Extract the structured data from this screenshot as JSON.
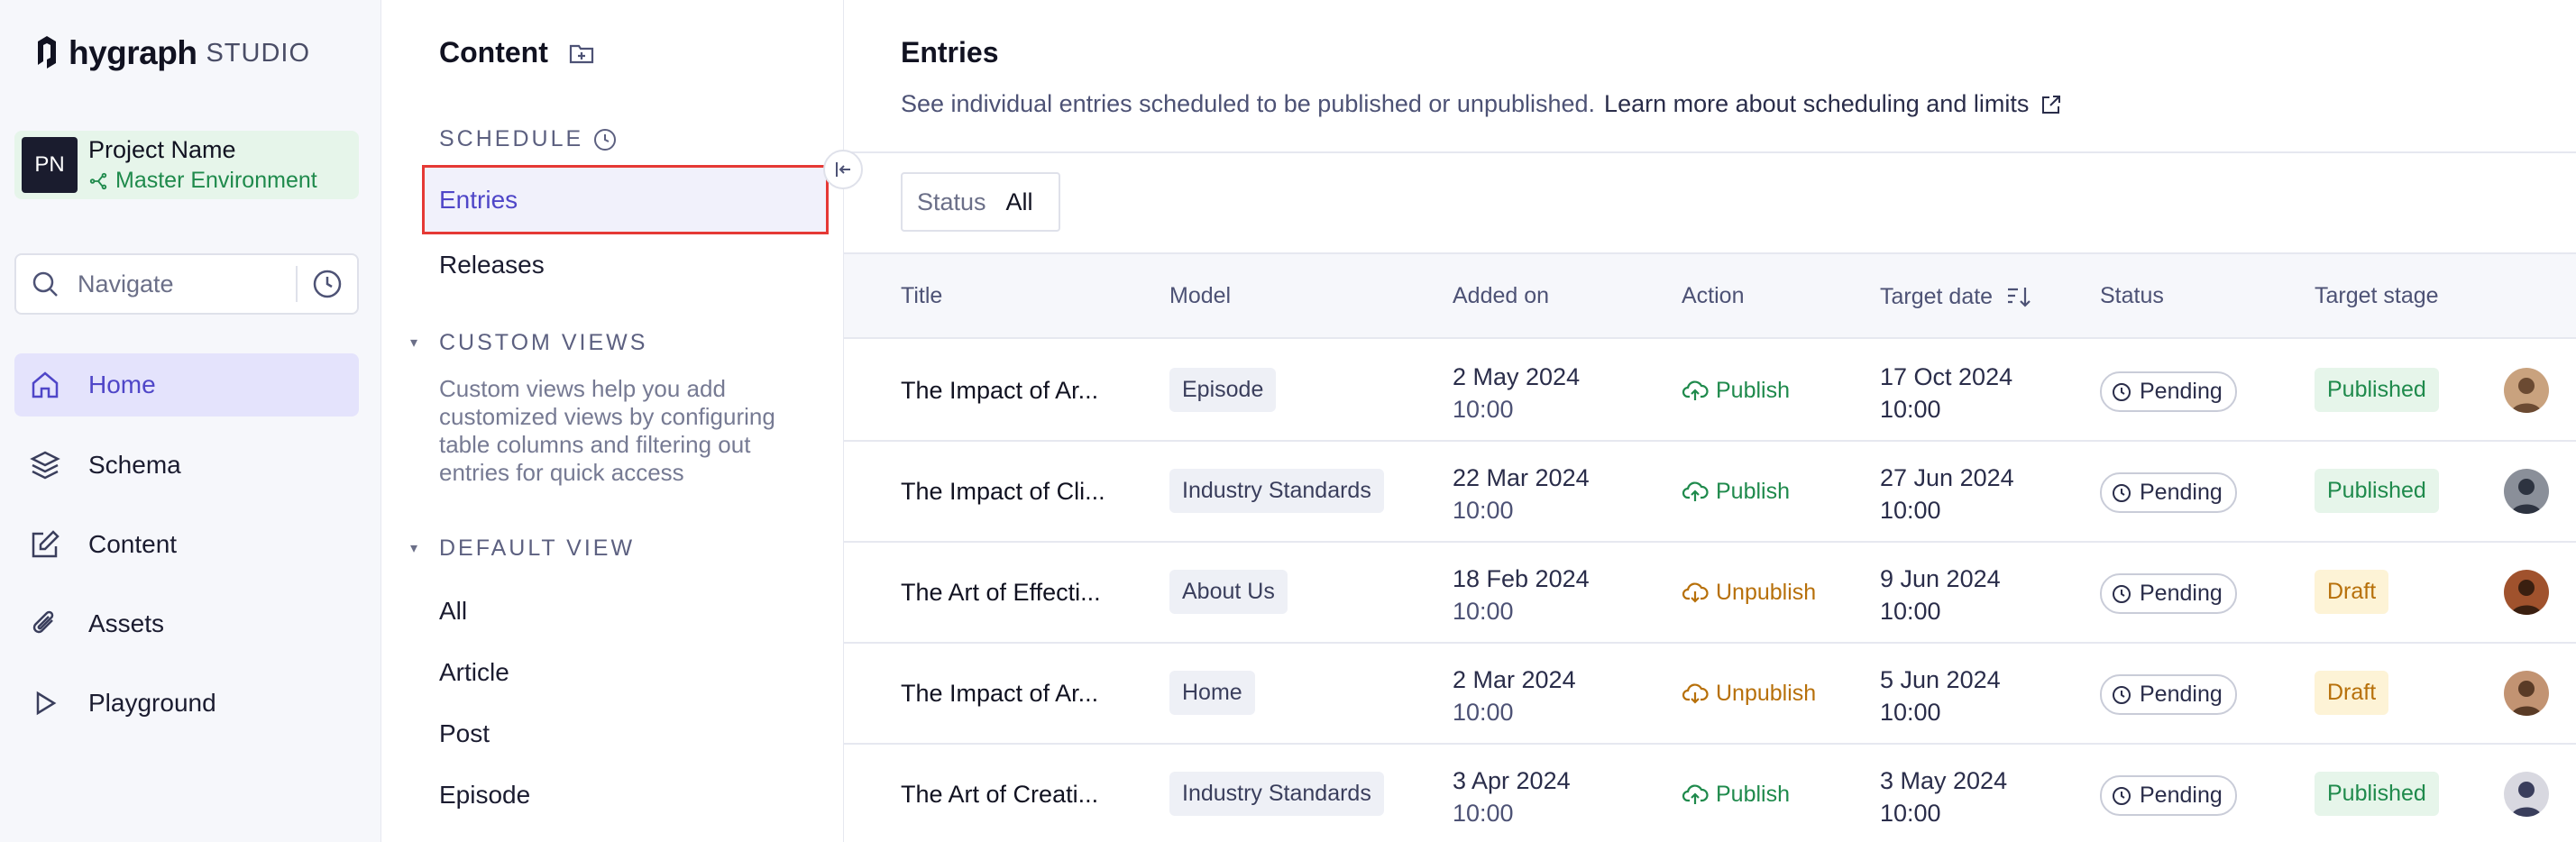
{
  "brand": {
    "name": "hygraph",
    "suffix": "STUDIO"
  },
  "project": {
    "initials": "PN",
    "name": "Project Name",
    "environment": "Master Environment"
  },
  "navigate": {
    "placeholder": "Navigate"
  },
  "nav": {
    "items": [
      {
        "label": "Home",
        "icon": "home-icon",
        "active": true
      },
      {
        "label": "Schema",
        "icon": "layers-icon"
      },
      {
        "label": "Content",
        "icon": "edit-icon"
      },
      {
        "label": "Assets",
        "icon": "paperclip-icon"
      },
      {
        "label": "Playground",
        "icon": "play-icon"
      }
    ]
  },
  "mid": {
    "title": "Content",
    "schedule_label": "SCHEDULE",
    "schedule_items": [
      "Entries",
      "Releases"
    ],
    "custom_views_label": "CUSTOM VIEWS",
    "custom_views_desc": "Custom views help you add customized views by configuring table columns and filtering out entries for quick access",
    "default_view_label": "DEFAULT VIEW",
    "default_view_items": [
      "All",
      "Article",
      "Post",
      "Episode"
    ]
  },
  "main": {
    "title": "Entries",
    "subtitle": "See individual entries scheduled to be published or unpublished.",
    "learn_more": "Learn more about scheduling and limits",
    "filter": {
      "key": "Status",
      "value": "All"
    },
    "columns": [
      "Title",
      "Model",
      "Added on",
      "Action",
      "Target date",
      "Status",
      "Target stage"
    ],
    "rows": [
      {
        "title": "The Impact of Ar...",
        "model": "Episode",
        "added_date": "2 May 2024",
        "added_time": "10:00",
        "action": "Publish",
        "target_date": "17 Oct 2024",
        "target_time": "10:00",
        "status": "Pending",
        "stage": "Published"
      },
      {
        "title": "The Impact of Cli...",
        "model": "Industry Standards",
        "added_date": "22 Mar 2024",
        "added_time": "10:00",
        "action": "Publish",
        "target_date": "27 Jun 2024",
        "target_time": "10:00",
        "status": "Pending",
        "stage": "Published"
      },
      {
        "title": "The Art of Effecti...",
        "model": "About Us",
        "added_date": "18 Feb 2024",
        "added_time": "10:00",
        "action": "Unpublish",
        "target_date": "9 Jun 2024",
        "target_time": "10:00",
        "status": "Pending",
        "stage": "Draft"
      },
      {
        "title": "The Impact of Ar...",
        "model": "Home",
        "added_date": "2 Mar 2024",
        "added_time": "10:00",
        "action": "Unpublish",
        "target_date": "5 Jun 2024",
        "target_time": "10:00",
        "status": "Pending",
        "stage": "Draft"
      },
      {
        "title": "The Art of Creati...",
        "model": "Industry Standards",
        "added_date": "3 Apr 2024",
        "added_time": "10:00",
        "action": "Publish",
        "target_date": "3 May 2024",
        "target_time": "10:00",
        "status": "Pending",
        "stage": "Published"
      }
    ]
  },
  "colors": {
    "accent": "#4f46c8",
    "publish": "#1f8a4c",
    "unpublish": "#b7700a",
    "highlight_border": "#e53935"
  }
}
